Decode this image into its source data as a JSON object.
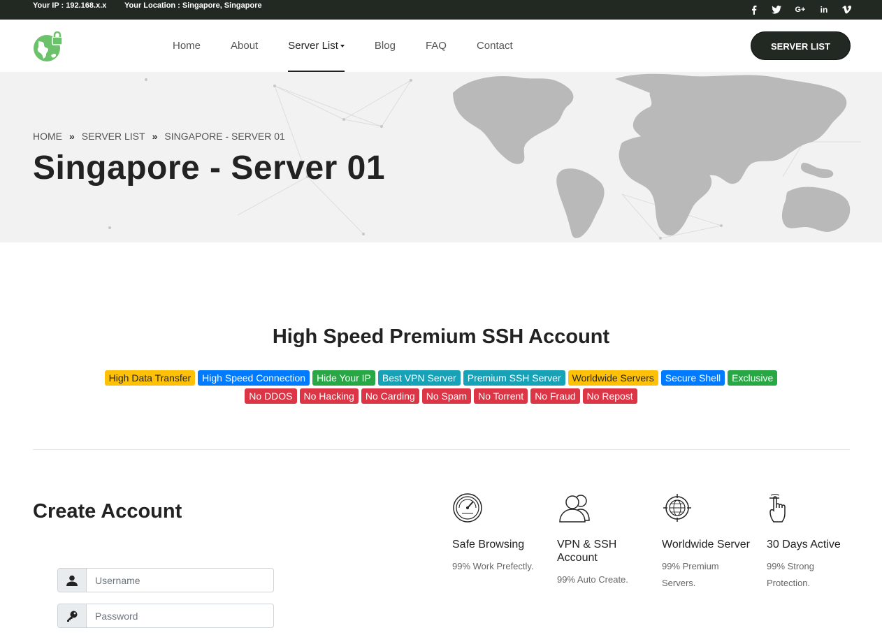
{
  "topbar": {
    "ip_text": "Your IP : 192.168.x.x",
    "location_text": "Your Location : Singapore, Singapore",
    "social_icons": [
      "facebook-icon",
      "twitter-icon",
      "google-plus-icon",
      "linkedin-icon",
      "vimeo-icon"
    ],
    "social_labels": [
      "f",
      "",
      "G+",
      "in",
      "v"
    ]
  },
  "nav": {
    "items": [
      {
        "label": "Home"
      },
      {
        "label": "About"
      },
      {
        "label": "Server List"
      },
      {
        "label": "Blog"
      },
      {
        "label": "FAQ"
      },
      {
        "label": "Contact"
      }
    ],
    "active_index": 2,
    "cta_label": "SERVER LIST"
  },
  "hero": {
    "breadcrumb": [
      "HOME",
      "SERVER LIST",
      "SINGAPORE - SERVER 01"
    ],
    "breadcrumb_sep": "»",
    "title": "Singapore - Server 01"
  },
  "section": {
    "title": "High Speed Premium SSH Account",
    "badges_row1": [
      {
        "label": "High Data Transfer",
        "color": "yellow"
      },
      {
        "label": "High Speed Connection",
        "color": "blue"
      },
      {
        "label": "Hide Your IP",
        "color": "green"
      },
      {
        "label": "Best VPN Server",
        "color": "teal"
      },
      {
        "label": "Premium SSH Server",
        "color": "teal"
      },
      {
        "label": "Worldwide Servers",
        "color": "yellow"
      },
      {
        "label": "Secure Shell",
        "color": "blue"
      },
      {
        "label": "Exclusive",
        "color": "green"
      }
    ],
    "badges_row2": [
      {
        "label": "No DDOS",
        "color": "red"
      },
      {
        "label": "No Hacking",
        "color": "red"
      },
      {
        "label": "No Carding",
        "color": "red"
      },
      {
        "label": "No Spam",
        "color": "red"
      },
      {
        "label": "No Torrent",
        "color": "red"
      },
      {
        "label": "No Fraud",
        "color": "red"
      },
      {
        "label": "No Repost",
        "color": "red"
      }
    ]
  },
  "form": {
    "title": "Create Account",
    "username_placeholder": "Username",
    "password_placeholder": "Password"
  },
  "features": [
    {
      "icon": "speedometer-icon",
      "title": "Safe Browsing",
      "desc": "99% Work Prefectly."
    },
    {
      "icon": "users-icon",
      "title": "VPN & SSH Account",
      "desc": "99% Auto Create."
    },
    {
      "icon": "globe-target-icon",
      "title": "Worldwide Server",
      "desc": "99% Premium Servers."
    },
    {
      "icon": "hand-pointer-icon",
      "title": "30 Days Active",
      "desc": "99% Strong Protection."
    }
  ],
  "colors": {
    "dark": "#222822",
    "logo_green": "#6cc16b",
    "yellow": "#ffc107",
    "blue": "#007bff",
    "green": "#28a745",
    "teal": "#17a2b8",
    "red": "#dc3545"
  }
}
